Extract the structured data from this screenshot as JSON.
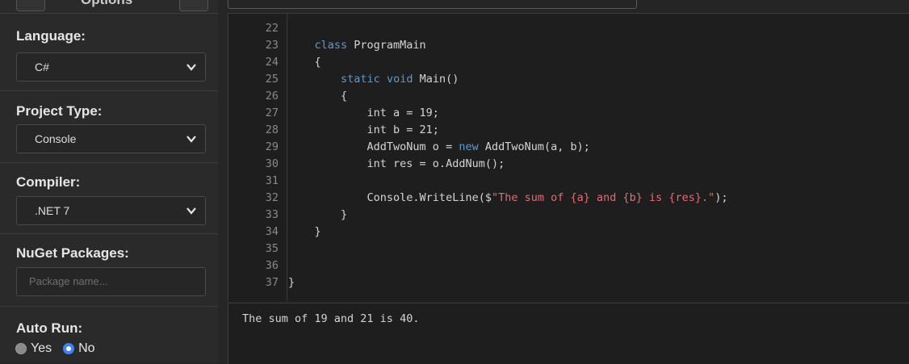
{
  "sidebar": {
    "header": {
      "label": "Options"
    },
    "language": {
      "label": "Language:",
      "value": "C#"
    },
    "project_type": {
      "label": "Project Type:",
      "value": "Console"
    },
    "compiler": {
      "label": "Compiler:",
      "value": ".NET 7"
    },
    "nuget": {
      "label": "NuGet Packages:",
      "placeholder": "Package name..."
    },
    "auto_run": {
      "label": "Auto Run:",
      "options": [
        "Yes",
        "No"
      ],
      "selected": "No"
    }
  },
  "editor": {
    "lines": [
      {
        "num": "22",
        "tokens": []
      },
      {
        "num": "23",
        "tokens": [
          [
            "    ",
            ""
          ],
          [
            "class",
            "kw"
          ],
          [
            " ProgramMain",
            ""
          ]
        ]
      },
      {
        "num": "24",
        "tokens": [
          [
            "    {",
            ""
          ]
        ]
      },
      {
        "num": "25",
        "tokens": [
          [
            "        ",
            ""
          ],
          [
            "static",
            "kw"
          ],
          [
            " ",
            ""
          ],
          [
            "void",
            "kw"
          ],
          [
            " Main()",
            ""
          ]
        ]
      },
      {
        "num": "26",
        "tokens": [
          [
            "        {",
            ""
          ]
        ]
      },
      {
        "num": "27",
        "tokens": [
          [
            "            int a = 19;",
            ""
          ]
        ]
      },
      {
        "num": "28",
        "tokens": [
          [
            "            int b = 21;",
            ""
          ]
        ]
      },
      {
        "num": "29",
        "tokens": [
          [
            "            AddTwoNum o = ",
            ""
          ],
          [
            "new",
            "kw"
          ],
          [
            " AddTwoNum(a, b);",
            ""
          ]
        ]
      },
      {
        "num": "30",
        "tokens": [
          [
            "            int res = o.AddNum();",
            ""
          ]
        ]
      },
      {
        "num": "31",
        "tokens": []
      },
      {
        "num": "32",
        "tokens": [
          [
            "            Console.WriteLine($",
            ""
          ],
          [
            "\"The sum of {a} and {b} is {res}.\"",
            "str"
          ],
          [
            ");",
            ""
          ]
        ]
      },
      {
        "num": "33",
        "tokens": [
          [
            "        }",
            ""
          ]
        ]
      },
      {
        "num": "34",
        "tokens": [
          [
            "    }",
            ""
          ]
        ]
      },
      {
        "num": "35",
        "tokens": []
      },
      {
        "num": "36",
        "tokens": []
      },
      {
        "num": "37",
        "tokens": [
          [
            "}",
            ""
          ]
        ]
      }
    ]
  },
  "output": {
    "text": "The sum of 19 and 21 is 40."
  },
  "colors": {
    "keyword": "#569cd6",
    "string": "#e06c75",
    "radio_selected": "#3b82f6"
  }
}
